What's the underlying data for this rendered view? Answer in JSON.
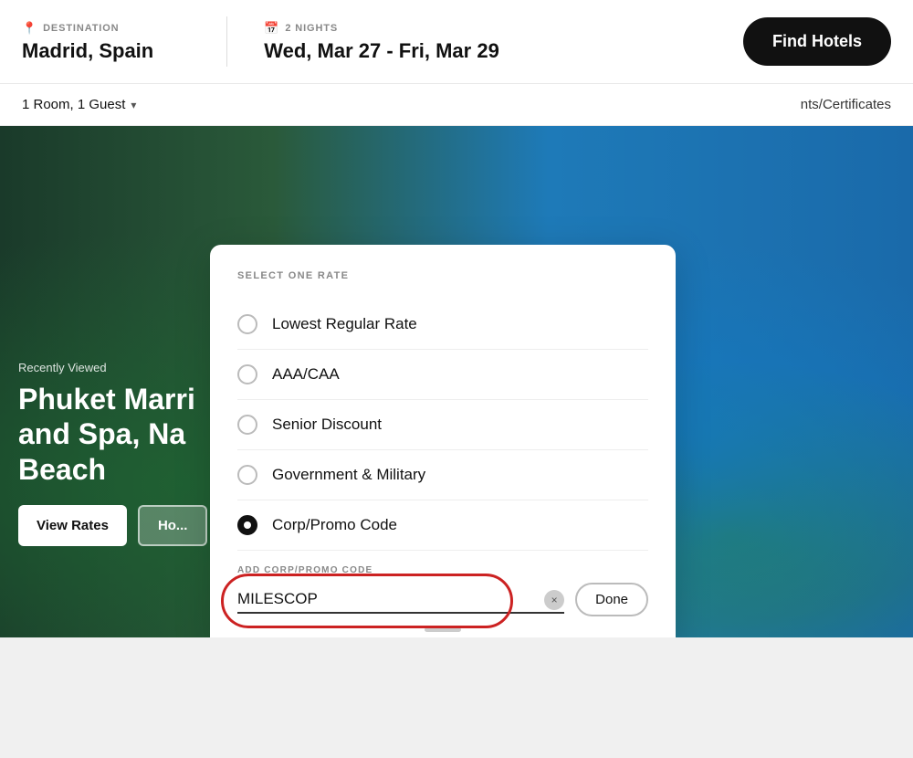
{
  "header": {
    "destination_label": "DESTINATION",
    "destination_value": "Madrid, Spain",
    "nights_label": "2 NIGHTS",
    "dates_value": "Wed, Mar 27 - Fri, Mar 29",
    "find_button": "Find Hotels"
  },
  "subheader": {
    "room_guest": "1 Room, 1 Guest",
    "certs_link": "nts/Certificates"
  },
  "hero": {
    "recently_viewed": "Recently Viewed",
    "hotel_name_line1": "Phuket Marri",
    "hotel_name_line2": "and Spa, Na",
    "hotel_name_line3": "Beach",
    "view_rates_btn": "View Rates",
    "hotel_info_btn": "Ho..."
  },
  "rate_dropdown": {
    "title": "SELECT ONE RATE",
    "rates": [
      {
        "id": "lowest",
        "label": "Lowest Regular Rate",
        "selected": false
      },
      {
        "id": "aaa",
        "label": "AAA/CAA",
        "selected": false
      },
      {
        "id": "senior",
        "label": "Senior Discount",
        "selected": false
      },
      {
        "id": "govt",
        "label": "Government & Military",
        "selected": false
      },
      {
        "id": "corp",
        "label": "Corp/Promo Code",
        "selected": true
      }
    ],
    "promo_section": {
      "label": "ADD CORP/PROMO CODE",
      "value": "MILESCOP",
      "placeholder": "",
      "done_btn": "Done",
      "clear_btn": "×"
    }
  }
}
